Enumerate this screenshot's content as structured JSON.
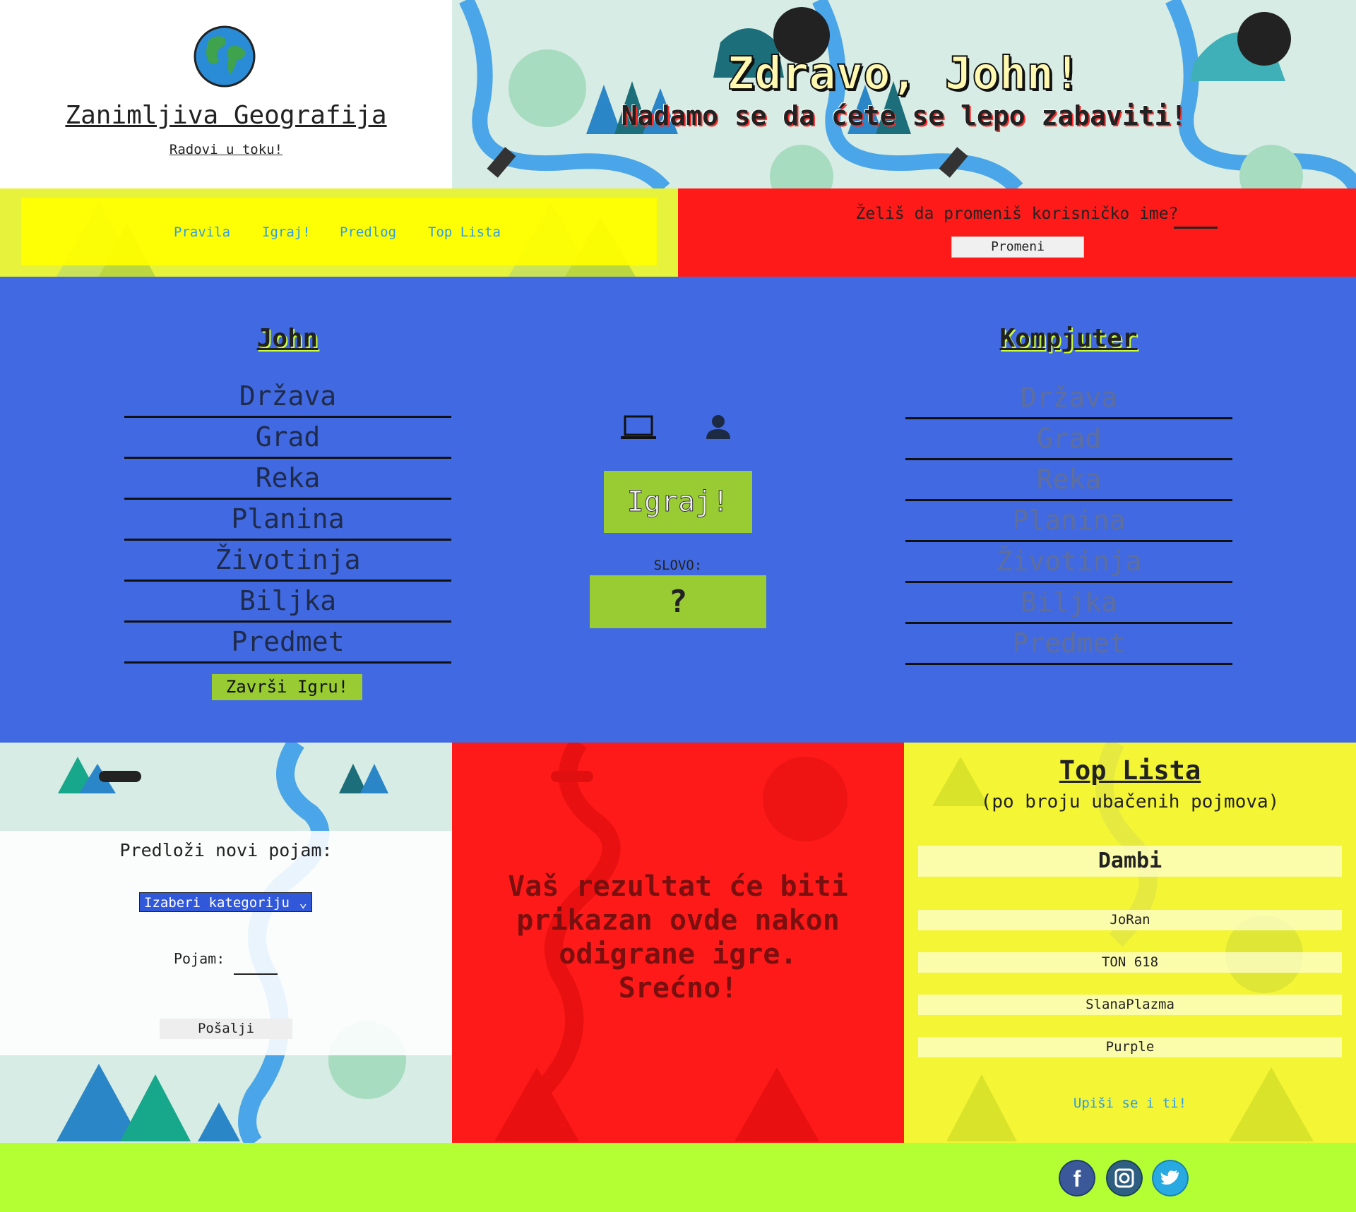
{
  "header": {
    "site_title": "Zanimljiva Geografija",
    "site_subtitle": "Radovi u toku!",
    "greeting": "Zdravo, John!",
    "greeting_sub": "Nadamo se da ćete se lepo zabaviti!"
  },
  "nav": {
    "items": [
      {
        "label": "Pravila"
      },
      {
        "label": "Igraj!"
      },
      {
        "label": "Predlog"
      },
      {
        "label": "Top Lista"
      }
    ]
  },
  "rename": {
    "label": "Želiš da promeniš korisničko ime?",
    "button": "Promeni"
  },
  "game": {
    "player": {
      "name": "John",
      "categories": [
        "Država",
        "Grad",
        "Reka",
        "Planina",
        "Životinja",
        "Biljka",
        "Predmet"
      ],
      "finish_button": "Završi Igru!"
    },
    "computer": {
      "name": "Kompjuter",
      "categories": [
        "Država",
        "Grad",
        "Reka",
        "Planina",
        "Životinja",
        "Biljka",
        "Predmet"
      ]
    },
    "play_button": "Igraj!",
    "letter_label": "SLOVO:",
    "letter_value": "?",
    "icons": [
      "laptop-icon",
      "person-icon"
    ]
  },
  "suggest": {
    "title": "Predloži novi pojam:",
    "category_select": "Izaberi kategoriju",
    "term_label": "Pojam:",
    "send_button": "Pošalji"
  },
  "result": {
    "lines": [
      "Vaš rezultat će biti",
      "prikazan ovde nakon",
      "odigrane igre.",
      "Srećno!"
    ]
  },
  "top_list": {
    "title": "Top Lista",
    "subtitle": "(po broju ubačenih pojmova)",
    "entries": [
      "Dambi",
      "JoRan",
      "TON 618",
      "SlanaPlazma",
      "Purple"
    ],
    "signup": "Upiši se i ti!"
  },
  "footer": {
    "social": [
      "facebook-icon",
      "instagram-icon",
      "twitter-icon"
    ]
  },
  "colors": {
    "game_bg": "#4169e1",
    "accent_green": "#99cc33",
    "nav_yellow": "#ffff00",
    "alert_red": "#ff1a1a",
    "footer_lime": "#b3ff33"
  }
}
